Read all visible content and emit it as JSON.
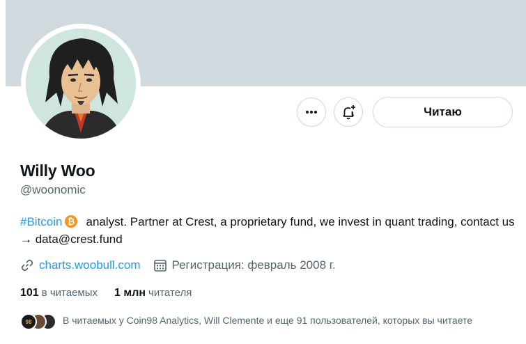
{
  "profile": {
    "name": "Willy Woo",
    "handle": "@woonomic",
    "follow_label": "Читаю",
    "bio_hashtag": "#Bitcoin",
    "bio_text": "analyst. Partner at Crest, a proprietary fund, we invest in quant trading, contact us → data@crest.fund",
    "website": "charts.woobull.com",
    "joined": "Регистрация: февраль 2008 г."
  },
  "stats": {
    "following_count": "101",
    "following_label": "в читаемых",
    "followers_count": "1 млн",
    "followers_label": "читателя"
  },
  "followers_you_know": {
    "text": "В читаемых у Coin98 Analytics, Will Clemente и еще 91 пользователей, которых вы читаете",
    "first_avatar_text": "98"
  },
  "icons": [
    "more-icon",
    "bell-plus-icon",
    "bitcoin-icon",
    "link-icon",
    "calendar-icon"
  ],
  "colors": {
    "accent": "#1d9bf0",
    "banner": "#cfd9de",
    "secondary_text": "#536471",
    "bitcoin": "#f7931a"
  }
}
